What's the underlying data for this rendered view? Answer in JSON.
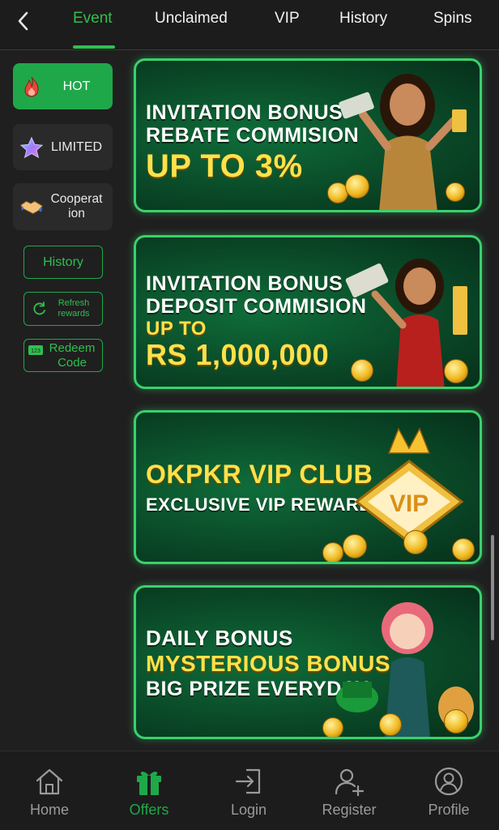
{
  "header": {
    "back_icon": "chevron-left-icon",
    "tabs": [
      {
        "label": "Event",
        "active": true
      },
      {
        "label": "Unclaimed",
        "active": false
      },
      {
        "label": "VIP",
        "active": false
      },
      {
        "label": "History",
        "active": false
      },
      {
        "label": "Spins",
        "active": false
      }
    ]
  },
  "sidebar": {
    "categories": [
      {
        "label": "HOT",
        "icon": "fire-icon",
        "active": true
      },
      {
        "label": "LIMITED",
        "icon": "star-icon",
        "active": false
      },
      {
        "label": "Cooperat ion",
        "icon": "handshake-icon",
        "active": false
      }
    ],
    "history_label": "History",
    "refresh_label": "Refresh rewards",
    "redeem_label": "Redeem Code"
  },
  "banners": [
    {
      "lines": [
        "INVITATION BONUS",
        "REBATE COMMISION",
        "UP TO 3%"
      ]
    },
    {
      "lines": [
        "INVITATION BONUS",
        "DEPOSIT COMMISION",
        "UP TO",
        "RS 1,000,000"
      ]
    },
    {
      "lines": [
        "OKPKR VIP CLUB",
        "EXCLUSIVE VIP REWARD"
      ],
      "badge": "VIP"
    },
    {
      "lines": [
        "DAILY BONUS",
        "MYSTERIOUS BONUS",
        "BIG PRIZE EVERYDAY"
      ]
    }
  ],
  "bottom_nav": [
    {
      "label": "Home",
      "icon": "home-icon",
      "active": false
    },
    {
      "label": "Offers",
      "icon": "gift-icon",
      "active": true
    },
    {
      "label": "Login",
      "icon": "login-icon",
      "active": false
    },
    {
      "label": "Register",
      "icon": "add-user-icon",
      "active": false
    },
    {
      "label": "Profile",
      "icon": "profile-icon",
      "active": false
    }
  ],
  "colors": {
    "accent": "#1fa84a",
    "banner_border": "#3ad16c",
    "gold_text": "#ffe14a"
  }
}
